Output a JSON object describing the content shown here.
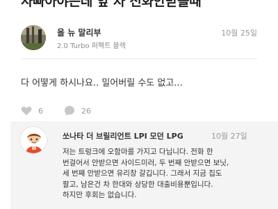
{
  "post": {
    "title": "사빠아야는데 앞 차 전화안받을때",
    "author": "올 뉴 말리부",
    "car": "2.0 Turbo 퍼펙트 블랙",
    "date": "10월 25일",
    "body": "다 어떻게 하시나요.. 밀어버릴 수도 없고...",
    "likes": "6",
    "comments": "26"
  },
  "comment": {
    "author": "쏘나타 더 브릴리언트 LPI 모던 LPG",
    "date": "10월 27일",
    "lines": [
      "저는 트렁크에 오함마를 가지고 다닙니다. 전화 한",
      "번걸어서 안받으면 사이드미러, 두 번째 안받으면 보닛,",
      "세 번째 안받으면 유리창 갈깁니다. 그래서 지금 집도",
      "팔고, 남은건 차 한대와 상당한 대출비용뿐입니다.",
      "하지만 후회는 없습니다."
    ]
  },
  "icons": {
    "like": "heart-icon",
    "comments": "speech-bubble-icon"
  },
  "colors": {
    "comment_background": "#f4f4f4",
    "meta_gray": "#999999"
  }
}
